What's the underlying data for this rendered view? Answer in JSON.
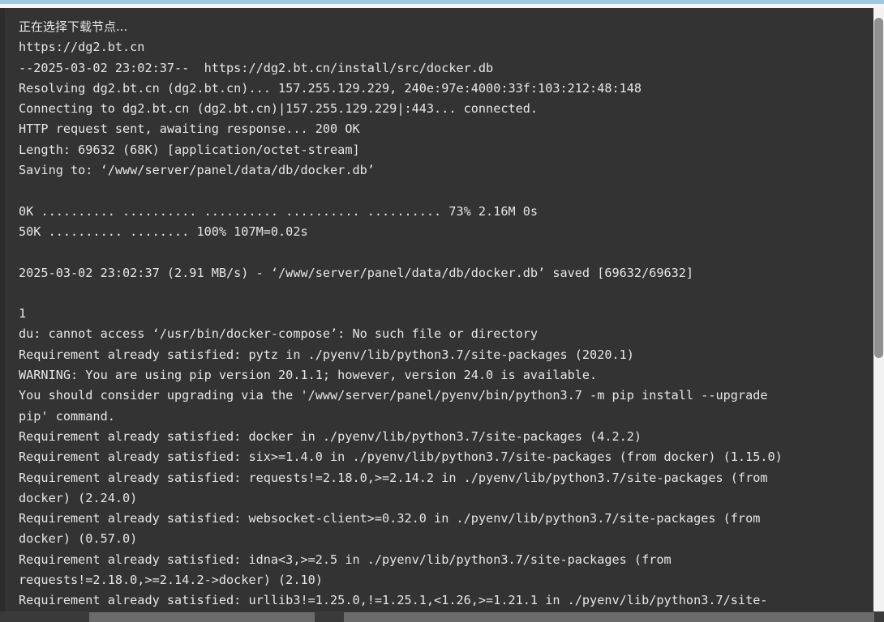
{
  "window": {
    "type": "terminal-console",
    "accent_color": "#9dc8e0",
    "background_color": "#333333",
    "text_color": "#e6e6e6"
  },
  "terminal": {
    "lines": [
      "正在选择下载节点...",
      "https://dg2.bt.cn",
      "--2025-03-02 23:02:37--  https://dg2.bt.cn/install/src/docker.db",
      "Resolving dg2.bt.cn (dg2.bt.cn)... 157.255.129.229, 240e:97e:4000:33f:103:212:48:148",
      "Connecting to dg2.bt.cn (dg2.bt.cn)|157.255.129.229|:443... connected.",
      "HTTP request sent, awaiting response... 200 OK",
      "Length: 69632 (68K) [application/octet-stream]",
      "Saving to: ‘/www/server/panel/data/db/docker.db’",
      "",
      "0K .......... .......... .......... .......... .......... 73% 2.16M 0s",
      "50K .......... ........ 100% 107M=0.02s",
      "",
      "2025-03-02 23:02:37 (2.91 MB/s) - ‘/www/server/panel/data/db/docker.db’ saved [69632/69632]",
      "",
      "1",
      "du: cannot access ‘/usr/bin/docker-compose’: No such file or directory",
      "Requirement already satisfied: pytz in ./pyenv/lib/python3.7/site-packages (2020.1)",
      "WARNING: You are using pip version 20.1.1; however, version 24.0 is available.",
      "You should consider upgrading via the '/www/server/panel/pyenv/bin/python3.7 -m pip install --upgrade",
      "pip' command.",
      "Requirement already satisfied: docker in ./pyenv/lib/python3.7/site-packages (4.2.2)",
      "Requirement already satisfied: six>=1.4.0 in ./pyenv/lib/python3.7/site-packages (from docker) (1.15.0)",
      "Requirement already satisfied: requests!=2.18.0,>=2.14.2 in ./pyenv/lib/python3.7/site-packages (from",
      "docker) (2.24.0)",
      "Requirement already satisfied: websocket-client>=0.32.0 in ./pyenv/lib/python3.7/site-packages (from",
      "docker) (0.57.0)",
      "Requirement already satisfied: idna<3,>=2.5 in ./pyenv/lib/python3.7/site-packages (from",
      "requests!=2.18.0,>=2.14.2->docker) (2.10)",
      "Requirement already satisfied: urllib3!=1.25.0,!=1.25.1,<1.26,>=1.21.1 in ./pyenv/lib/python3.7/site-"
    ]
  },
  "scrollbars": {
    "vertical_thumb_position_percent": 2,
    "vertical_thumb_size_percent": 56,
    "horizontal_visible": true
  }
}
